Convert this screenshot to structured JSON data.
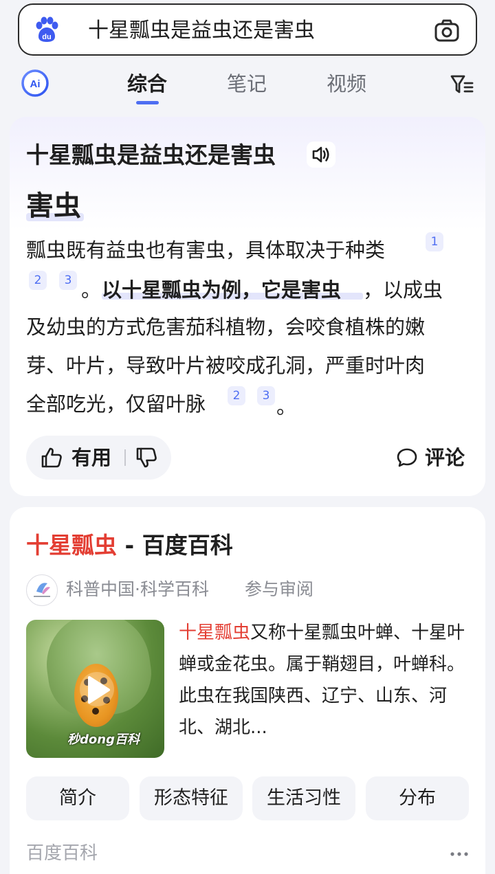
{
  "search": {
    "query": "十星瓢虫是益虫还是害虫"
  },
  "tabs": {
    "items": [
      "综合",
      "笔记",
      "视频"
    ],
    "active_index": 0
  },
  "answer_card": {
    "question_title": "十星瓢虫是益虫还是害虫",
    "answer": "害虫",
    "line1": "瓢虫既有益虫也有害虫，具体取决于种类",
    "line2_end": "。",
    "line2_highlight": "以十星瓢虫为例，它是害虫",
    "line2_tail": "，以成虫",
    "line3": "及幼虫的方式危害茄科植物，会咬食植株的嫩",
    "line4": "芽、叶片，导致叶片被咬成孔洞，严重时叶肉",
    "line5": "全部吃光，仅留叶脉",
    "line5_end": "。",
    "citations": {
      "c1": "1",
      "c2": "2",
      "c3": "3"
    },
    "useful_label": "有用",
    "comment_label": "评论"
  },
  "baike_card": {
    "title_keyword": "十星瓢虫",
    "title_sep": " - ",
    "title_source": "百度百科",
    "source_name": "科普中国·科学百科",
    "source_review": "参与审阅",
    "video_watermark": "秒dong百科",
    "summary_keyword": "十星瓢虫",
    "summary_rest": "又称十星瓢虫叶蝉、十星叶蝉或金花虫。属于鞘翅目，叶蝉科。此虫在我国陕西、辽宁、山东、河北、湖北...",
    "sections": [
      "简介",
      "形态特征",
      "生活习性",
      "分布"
    ],
    "footer_source": "百度百科"
  },
  "colors": {
    "accent": "#4e6ef2",
    "keyword_red": "#e33e33",
    "citation_bg": "#eceefd",
    "page_bg": "#f3f4f8"
  },
  "icons": {
    "logo": "baidu-paw-logo",
    "camera": "camera-icon",
    "ai": "ai-assistant-icon",
    "filter": "filter-icon",
    "speaker": "speaker-icon",
    "like": "thumb-up-icon",
    "dislike": "thumb-down-icon",
    "comment": "comment-icon",
    "play": "play-icon",
    "more": "more-dots-icon"
  }
}
